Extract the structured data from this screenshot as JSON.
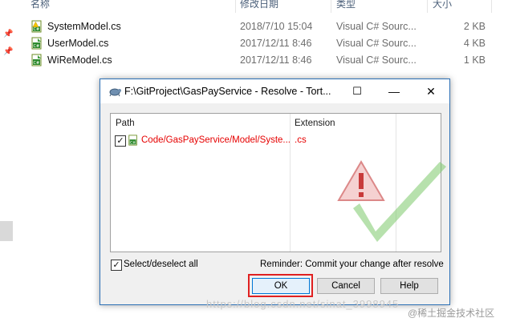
{
  "explorer": {
    "columns": [
      "名称",
      "修改日期",
      "类型",
      "大小"
    ],
    "files": [
      {
        "name": "SystemModel.cs",
        "date": "2018/7/10 15:04",
        "type": "Visual C# Sourc...",
        "size": "2 KB",
        "icon": "csharp-conflict-file-icon"
      },
      {
        "name": "UserModel.cs",
        "date": "2017/12/11 8:46",
        "type": "Visual C# Sourc...",
        "size": "4 KB",
        "icon": "csharp-file-icon"
      },
      {
        "name": "WiReModel.cs",
        "date": "2017/12/11 8:46",
        "type": "Visual C# Sourc...",
        "size": "1 KB",
        "icon": "csharp-file-icon"
      }
    ]
  },
  "dialog": {
    "title": "F:\\GitProject\\GasPayService - Resolve - Tort...",
    "title_icon": "tortoise-icon",
    "list": {
      "columns": {
        "path": "Path",
        "extension": "Extension"
      },
      "rows": [
        {
          "checked": true,
          "path": "Code/GasPayService/Model/Syste...",
          "extension": ".cs",
          "icon": "csharp-file-icon"
        }
      ]
    },
    "select_all_label": "Select/deselect all",
    "select_all_checked": true,
    "reminder": "Reminder: Commit your change after resolve",
    "buttons": {
      "ok": "OK",
      "cancel": "Cancel",
      "help": "Help"
    }
  },
  "watermarks": {
    "blog": "https://blog.csdn.net/sinat_3998945",
    "site": "@稀土掘金技术社区"
  },
  "colors": {
    "conflict_red": "#e60000",
    "accent": "#0078d7",
    "highlight": "#e02020"
  }
}
